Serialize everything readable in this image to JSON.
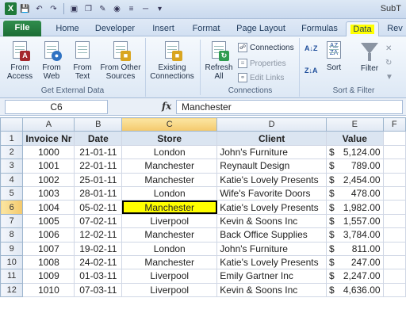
{
  "window": {
    "title": "SubT"
  },
  "tabs": {
    "file": "File",
    "home": "Home",
    "developer": "Developer",
    "insert": "Insert",
    "format": "Format",
    "page_layout": "Page Layout",
    "formulas": "Formulas",
    "data": "Data",
    "review": "Rev"
  },
  "ribbon": {
    "from_access": "From Access",
    "from_web": "From Web",
    "from_text": "From Text",
    "from_other_sources": "From Other Sources",
    "existing_connections": "Existing Connections",
    "get_external_data": "Get External Data",
    "refresh_all": "Refresh All",
    "connections": "Connections",
    "properties": "Properties",
    "edit_links": "Edit Links",
    "connections_group": "Connections",
    "sort": "Sort",
    "filter": "Filter",
    "sort_filter_group": "Sort & Filter"
  },
  "formula_bar": {
    "name_box": "C6",
    "fx": "fx",
    "content": "Manchester"
  },
  "columns": [
    "A",
    "B",
    "C",
    "D",
    "E",
    "F"
  ],
  "header_row": {
    "invoice": "Invoice Nr",
    "date": "Date",
    "store": "Store",
    "client": "Client",
    "value": "Value"
  },
  "rows": [
    {
      "n": "2",
      "inv": "1000",
      "date": "21-01-11",
      "store": "London",
      "client": "John's Furniture",
      "cur": "$",
      "val": "5,124.00"
    },
    {
      "n": "3",
      "inv": "1001",
      "date": "22-01-11",
      "store": "Manchester",
      "client": "Reynault Design",
      "cur": "$",
      "val": "789.00"
    },
    {
      "n": "4",
      "inv": "1002",
      "date": "25-01-11",
      "store": "Manchester",
      "client": "Katie's Lovely Presents",
      "cur": "$",
      "val": "2,454.00"
    },
    {
      "n": "5",
      "inv": "1003",
      "date": "28-01-11",
      "store": "London",
      "client": "Wife's Favorite Doors",
      "cur": "$",
      "val": "478.00"
    },
    {
      "n": "6",
      "inv": "1004",
      "date": "05-02-11",
      "store": "Manchester",
      "client": "Katie's Lovely Presents",
      "cur": "$",
      "val": "1,982.00"
    },
    {
      "n": "7",
      "inv": "1005",
      "date": "07-02-11",
      "store": "Liverpool",
      "client": "Kevin & Soons Inc",
      "cur": "$",
      "val": "1,557.00"
    },
    {
      "n": "8",
      "inv": "1006",
      "date": "12-02-11",
      "store": "Manchester",
      "client": "Back Office Supplies",
      "cur": "$",
      "val": "3,784.00"
    },
    {
      "n": "9",
      "inv": "1007",
      "date": "19-02-11",
      "store": "London",
      "client": "John's Furniture",
      "cur": "$",
      "val": "811.00"
    },
    {
      "n": "10",
      "inv": "1008",
      "date": "24-02-11",
      "store": "Manchester",
      "client": "Katie's Lovely Presents",
      "cur": "$",
      "val": "247.00"
    },
    {
      "n": "11",
      "inv": "1009",
      "date": "01-03-11",
      "store": "Liverpool",
      "client": "Emily Gartner Inc",
      "cur": "$",
      "val": "2,247.00"
    },
    {
      "n": "12",
      "inv": "1010",
      "date": "07-03-11",
      "store": "Liverpool",
      "client": "Kevin & Soons Inc",
      "cur": "$",
      "val": "4,636.00"
    }
  ],
  "row_numbers": {
    "header": "1"
  },
  "colors": {
    "active_cell": "#ffff00",
    "file_tab": "#1d6e36",
    "header_fill": "#dbe5f1"
  }
}
